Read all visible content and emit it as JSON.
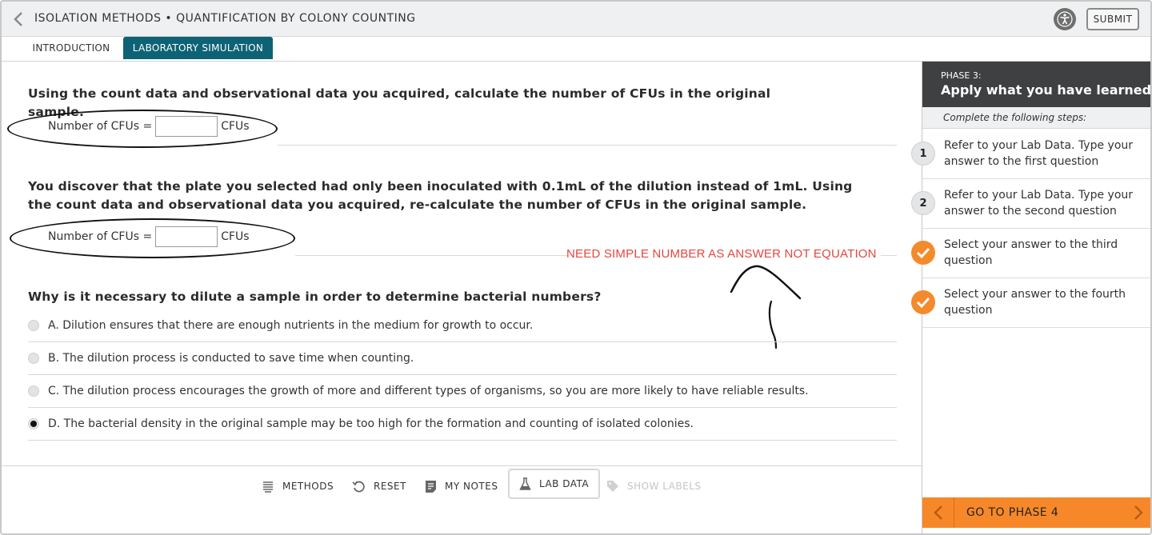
{
  "header": {
    "title": "ISOLATION METHODS • QUANTIFICATION BY COLONY COUNTING",
    "back_icon": "chevron-left-icon",
    "accessibility_icon": "accessibility-icon",
    "submit_label": "SUBMIT"
  },
  "tabs": [
    {
      "label": "INTRODUCTION",
      "active": false
    },
    {
      "label": "LABORATORY SIMULATION",
      "active": true
    }
  ],
  "questions": {
    "q1": {
      "text": "Using the count data and observational data you acquired, calculate the number of CFUs in the original sample.",
      "field_label": "Number of CFUs =",
      "value": "",
      "unit": "CFUs"
    },
    "q2": {
      "text": "You discover that the plate you selected had only been inoculated with 0.1mL of the dilution instead of 1mL. Using the count data and observational data you acquired, re-calculate the number of CFUs in the original sample.",
      "field_label": "Number of CFUs =",
      "value": "",
      "unit": "CFUs"
    },
    "q3": {
      "text": "Why is it necessary to dilute a sample in order to determine bacterial numbers?",
      "options": [
        {
          "label": "A. Dilution ensures that there are enough nutrients in the medium for growth to occur.",
          "selected": false
        },
        {
          "label": "B. The dilution process is conducted to save time when counting.",
          "selected": false
        },
        {
          "label": "C. The dilution process encourages the growth of more and different types of organisms, so you are more likely to have reliable results.",
          "selected": false
        },
        {
          "label": "D. The bacterial density in the original sample may be too high for the formation and counting of isolated colonies.",
          "selected": true
        }
      ]
    }
  },
  "annotation": "NEED SIMPLE NUMBER AS ANSWER NOT EQUATION",
  "toolbar": [
    {
      "label": "METHODS",
      "icon": "list-icon",
      "disabled": false
    },
    {
      "label": "RESET",
      "icon": "reset-icon",
      "disabled": false
    },
    {
      "label": "MY NOTES",
      "icon": "notes-icon",
      "disabled": false
    },
    {
      "label": "LAB DATA",
      "icon": "flask-icon",
      "disabled": false,
      "active": true
    },
    {
      "label": "SHOW LABELS",
      "icon": "tag-icon",
      "disabled": true
    }
  ],
  "side_panel": {
    "phase_label": "PHASE 3:",
    "phase_title": "Apply what you have learned",
    "steps_intro": "Complete the following steps:",
    "steps": [
      {
        "number": "1",
        "text": "Refer to your Lab Data. Type your answer to the first question",
        "done": false
      },
      {
        "number": "2",
        "text": "Refer to your Lab Data. Type your answer to the second question",
        "done": false
      },
      {
        "number": "3",
        "text": "Select your answer to the third question",
        "done": true
      },
      {
        "number": "4",
        "text": "Select your answer to the fourth question",
        "done": true
      }
    ],
    "next_phase_label": "GO TO PHASE 4"
  },
  "colors": {
    "accent": "#0e6275",
    "orange": "#f7882a",
    "annotation": "#e6453d",
    "panel_header": "#3f4042"
  }
}
